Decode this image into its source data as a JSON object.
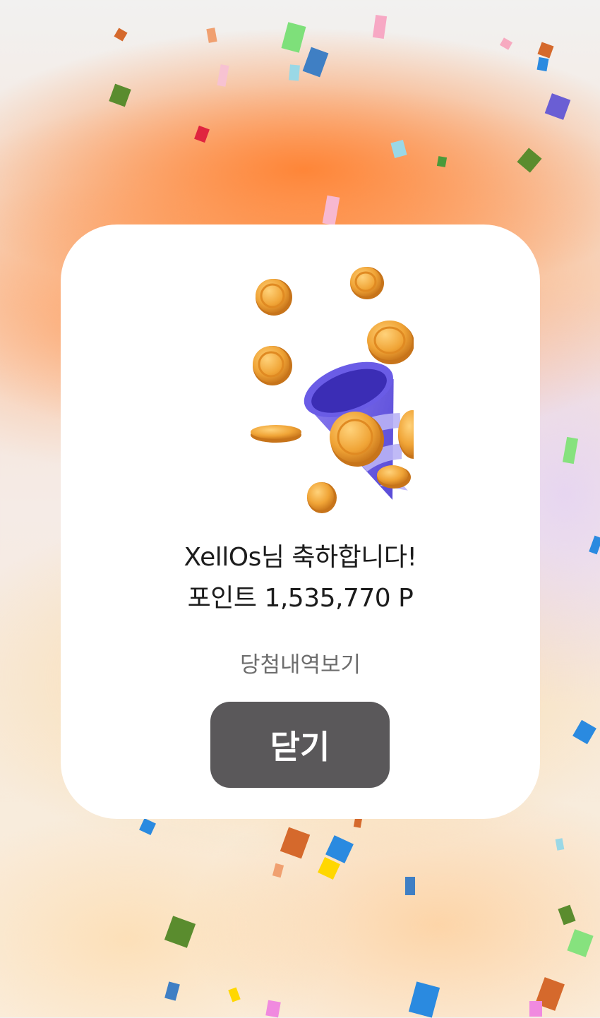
{
  "dialog": {
    "congrats_message": "XellOs님 축하합니다!",
    "points_message": "포인트 1,535,770 P",
    "history_link_label": "당첨내역보기",
    "close_button_label": "닫기"
  },
  "illustration": {
    "icon": "party-popper-coins-icon"
  },
  "colors": {
    "card_background": "#ffffff",
    "close_button": "#5a585a",
    "history_link_text": "#6d6d6d",
    "background_accent": "#ff8c42"
  }
}
